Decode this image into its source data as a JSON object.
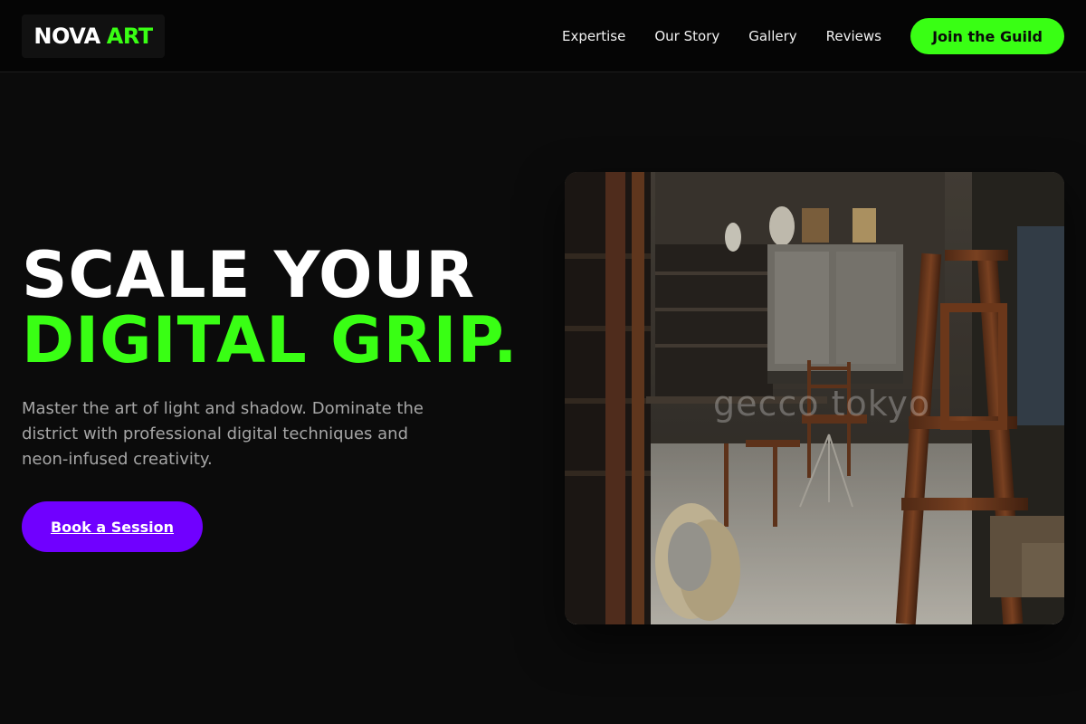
{
  "brand": {
    "name_primary": "NOVA",
    "name_accent": "ART"
  },
  "nav": {
    "items": [
      {
        "label": "Expertise"
      },
      {
        "label": "Our Story"
      },
      {
        "label": "Gallery"
      },
      {
        "label": "Reviews"
      }
    ],
    "cta_label": "Join the Guild"
  },
  "hero": {
    "headline_line1": "SCALE YOUR",
    "headline_line2": "DIGITAL GRIP.",
    "subtext": "Master the art of light and shadow. Dominate the district with professional digital techniques and neon-infused creativity.",
    "cta_label": "Book a Session",
    "image": {
      "subject": "artist-studio-with-wooden-easels",
      "watermark": "gecco tokyo"
    }
  },
  "colors": {
    "accent_green": "#39ff14",
    "accent_purple": "#7000ff",
    "background": "#0b0b0b",
    "header_background": "#050505",
    "body_text": "#a6a6a6"
  }
}
